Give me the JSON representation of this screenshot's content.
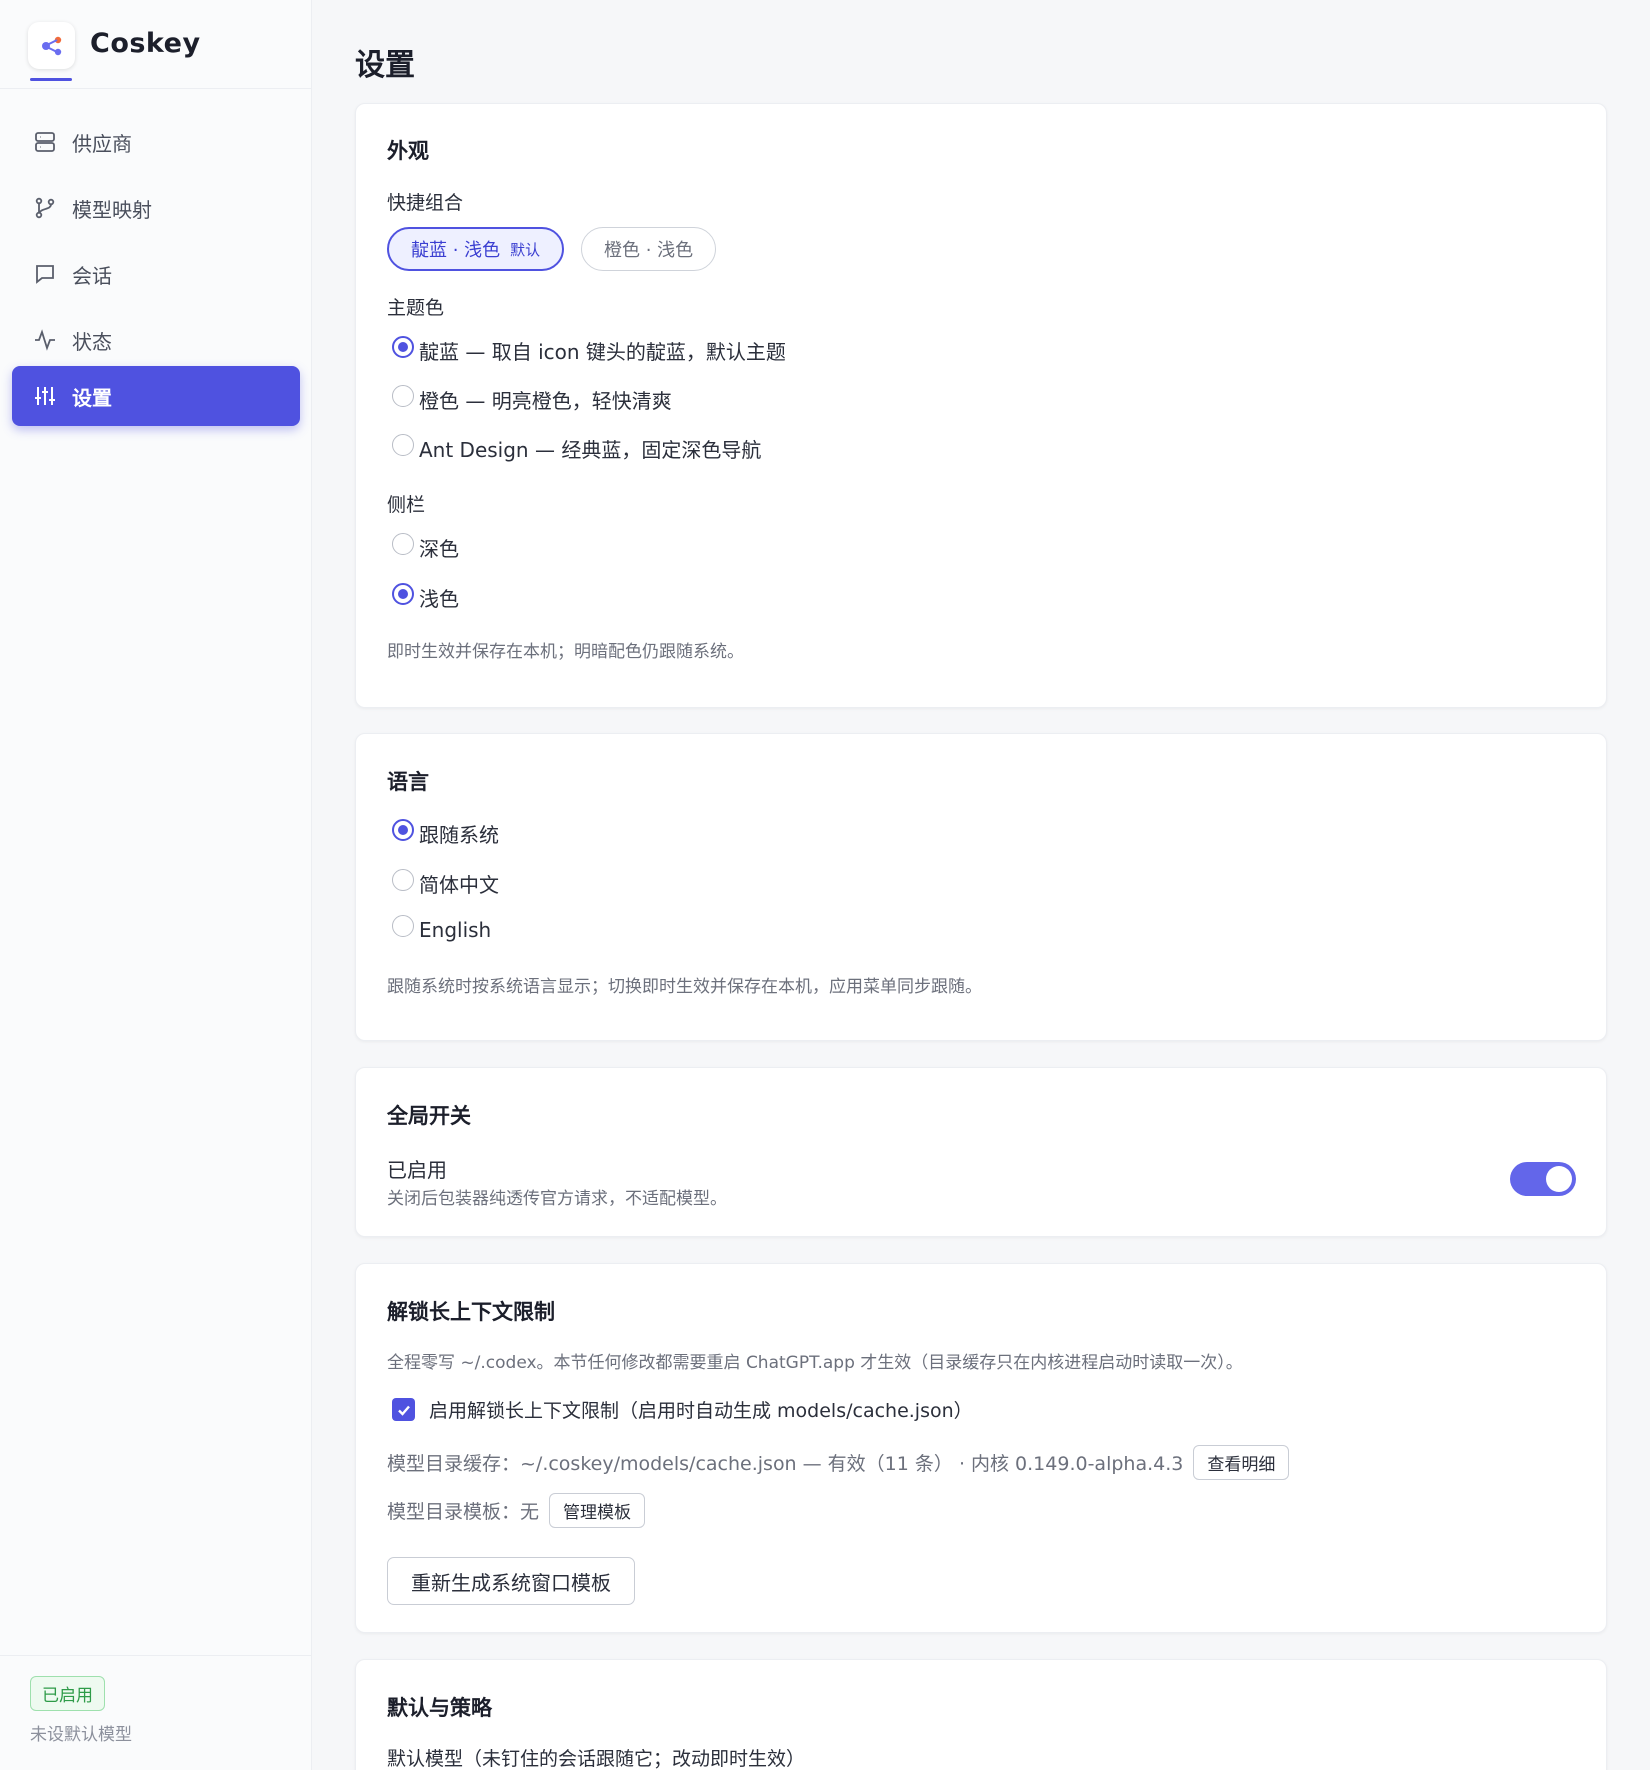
{
  "app": {
    "name": "Coskey"
  },
  "nav": [
    {
      "label": "供应商",
      "icon": "server-icon"
    },
    {
      "label": "模型映射",
      "icon": "branch-icon"
    },
    {
      "label": "会话",
      "icon": "chat-icon"
    },
    {
      "label": "状态",
      "icon": "activity-icon"
    },
    {
      "label": "设置",
      "icon": "sliders-icon",
      "active": true
    }
  ],
  "sidebar_footer": {
    "badge": "已启用",
    "note": "未设默认模型"
  },
  "page": {
    "title": "设置"
  },
  "appearance": {
    "title": "外观",
    "presets_label": "快捷组合",
    "presets": [
      {
        "label": "靛蓝 · 浅色",
        "tag": "默认",
        "selected": true
      },
      {
        "label": "橙色 · 浅色",
        "selected": false
      }
    ],
    "theme_label": "主题色",
    "themes": [
      {
        "label": "靛蓝 — 取自 icon 键头的靛蓝，默认主题",
        "selected": true
      },
      {
        "label": "橙色 — 明亮橙色，轻快清爽",
        "selected": false
      },
      {
        "label": "Ant Design — 经典蓝，固定深色导航",
        "selected": false
      }
    ],
    "sidebar_label": "侧栏",
    "sidebar_options": [
      {
        "label": "深色",
        "selected": false
      },
      {
        "label": "浅色",
        "selected": true
      }
    ],
    "hint": "即时生效并保存在本机；明暗配色仍跟随系统。"
  },
  "language": {
    "title": "语言",
    "options": [
      {
        "label": "跟随系统",
        "selected": true
      },
      {
        "label": "简体中文",
        "selected": false
      },
      {
        "label": "English",
        "selected": false
      }
    ],
    "hint": "跟随系统时按系统语言显示；切换即时生效并保存在本机，应用菜单同步跟随。"
  },
  "global_switch": {
    "title": "全局开关",
    "status": "已启用",
    "desc": "关闭后包装器纯透传官方请求，不适配模型。",
    "enabled": true
  },
  "unlock_context": {
    "title": "解锁长上下文限制",
    "desc": "全程零写 ~/.codex。本节任何修改都需要重启 ChatGPT.app 才生效（目录缓存只在内核进程启动时读取一次）。",
    "checkbox_label": "启用解锁长上下文限制（启用时自动生成 models/cache.json）",
    "checked": true,
    "cache_text": "模型目录缓存：~/.coskey/models/cache.json — 有效（11 条） · 内核 0.149.0-alpha.4.3",
    "cache_button": "查看明细",
    "template_text": "模型目录模板：无",
    "template_button": "管理模板",
    "regen_button": "重新生成系统窗口模板"
  },
  "defaults": {
    "title": "默认与策略",
    "default_model_label": "默认模型（未钉住的会话跟随它；改动即时生效）"
  },
  "colors": {
    "accent": "#4f52e0",
    "success": "#2e9b48"
  }
}
